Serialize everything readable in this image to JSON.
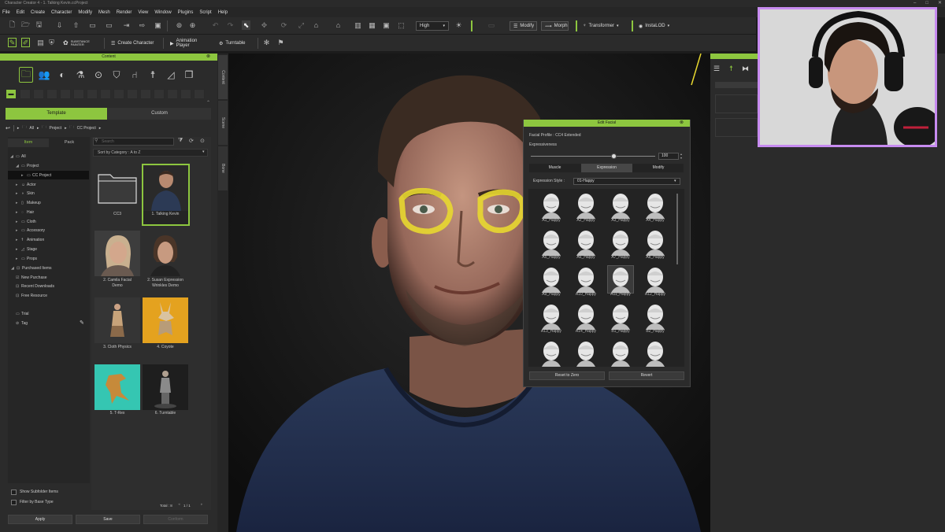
{
  "window": {
    "title": "Character Creator 4 - 1. Talking Kevin.ccProject"
  },
  "menu": [
    "File",
    "Edit",
    "Create",
    "Character",
    "Modify",
    "Mesh",
    "Render",
    "View",
    "Window",
    "Plugins",
    "Script",
    "Help"
  ],
  "toolbar1": {
    "quality": "High",
    "modify": "Modify",
    "morph": "Morph",
    "transformer": "Transformer",
    "instalod": "InstaLOD"
  },
  "toolbar2": {
    "substance": "SUBSTANCE PAINTER",
    "create_character": "Create Character",
    "animation_player": "Animation Player",
    "turntable": "Turntable"
  },
  "content": {
    "header": "Content",
    "tabs": {
      "template": "Template",
      "custom": "Custom"
    },
    "breadcrumb": [
      "All",
      "Project",
      "CC Project"
    ],
    "subtabs": {
      "item": "Item",
      "pack": "Pack"
    },
    "search_placeholder": "Search",
    "sort": "Sort by Category : A to Z",
    "tree": [
      "All",
      "Project",
      "CC Project",
      "Actor",
      "Skin",
      "Makeup",
      "Hair",
      "Cloth",
      "Accessory",
      "Animation",
      "Stage",
      "Props",
      "Purchased Items",
      "New Purchase",
      "Recent Downloads",
      "Free Resource",
      "Trial",
      "Tag"
    ],
    "items": [
      {
        "line1": "CC3",
        "line2": ""
      },
      {
        "line1": "1. Talking Kevin",
        "line2": ""
      },
      {
        "line1": "2. Camila Facial",
        "line2": "Demo"
      },
      {
        "line1": "2. Susan Expression",
        "line2": "Wrinkles Demo"
      },
      {
        "line1": "3. Cloth Physics",
        "line2": ""
      },
      {
        "line1": "4. Coyote",
        "line2": ""
      },
      {
        "line1": "5. T-Rex",
        "line2": ""
      },
      {
        "line1": "6. Turntable",
        "line2": ""
      }
    ],
    "total": "Total : 8",
    "page": "1 / 1",
    "show_subfolder": "Show Subfolder Items",
    "filter_base": "Filter by Base Type",
    "apply": "Apply",
    "save": "Save",
    "conform": "Conform"
  },
  "side_tabs": [
    "Content",
    "Scene",
    "Bone"
  ],
  "edit_facial": {
    "title": "Edit Facial",
    "profile": "Facial Profile : CC4 Extended",
    "expressiveness_label": "Expressiveness",
    "expressiveness": 100,
    "tabs": {
      "muscle": "Muscle",
      "expression": "Expression",
      "modify": "Modify"
    },
    "style_label": "Expression Style :",
    "style_value": "01-Happy",
    "faces": [
      "A1_Happy",
      "A2_Happy",
      "A3_Happy",
      "A4_Happy",
      "A5_Happy",
      "A6_Happy",
      "A7_Happy",
      "A8_Happy",
      "A9_Happy",
      "A10_Happy",
      "A11_Happy",
      "A12_Happy",
      "A13_Happy",
      "A14_Happy",
      "B1_Happy",
      "B2_Happy"
    ],
    "reset": "Reset to Zero",
    "revert": "Revert"
  },
  "colors": {
    "accent": "#8dc63f",
    "panel": "#2b2b2b",
    "webcam_border": "#c78bf0",
    "highlight": "#e8d830"
  }
}
